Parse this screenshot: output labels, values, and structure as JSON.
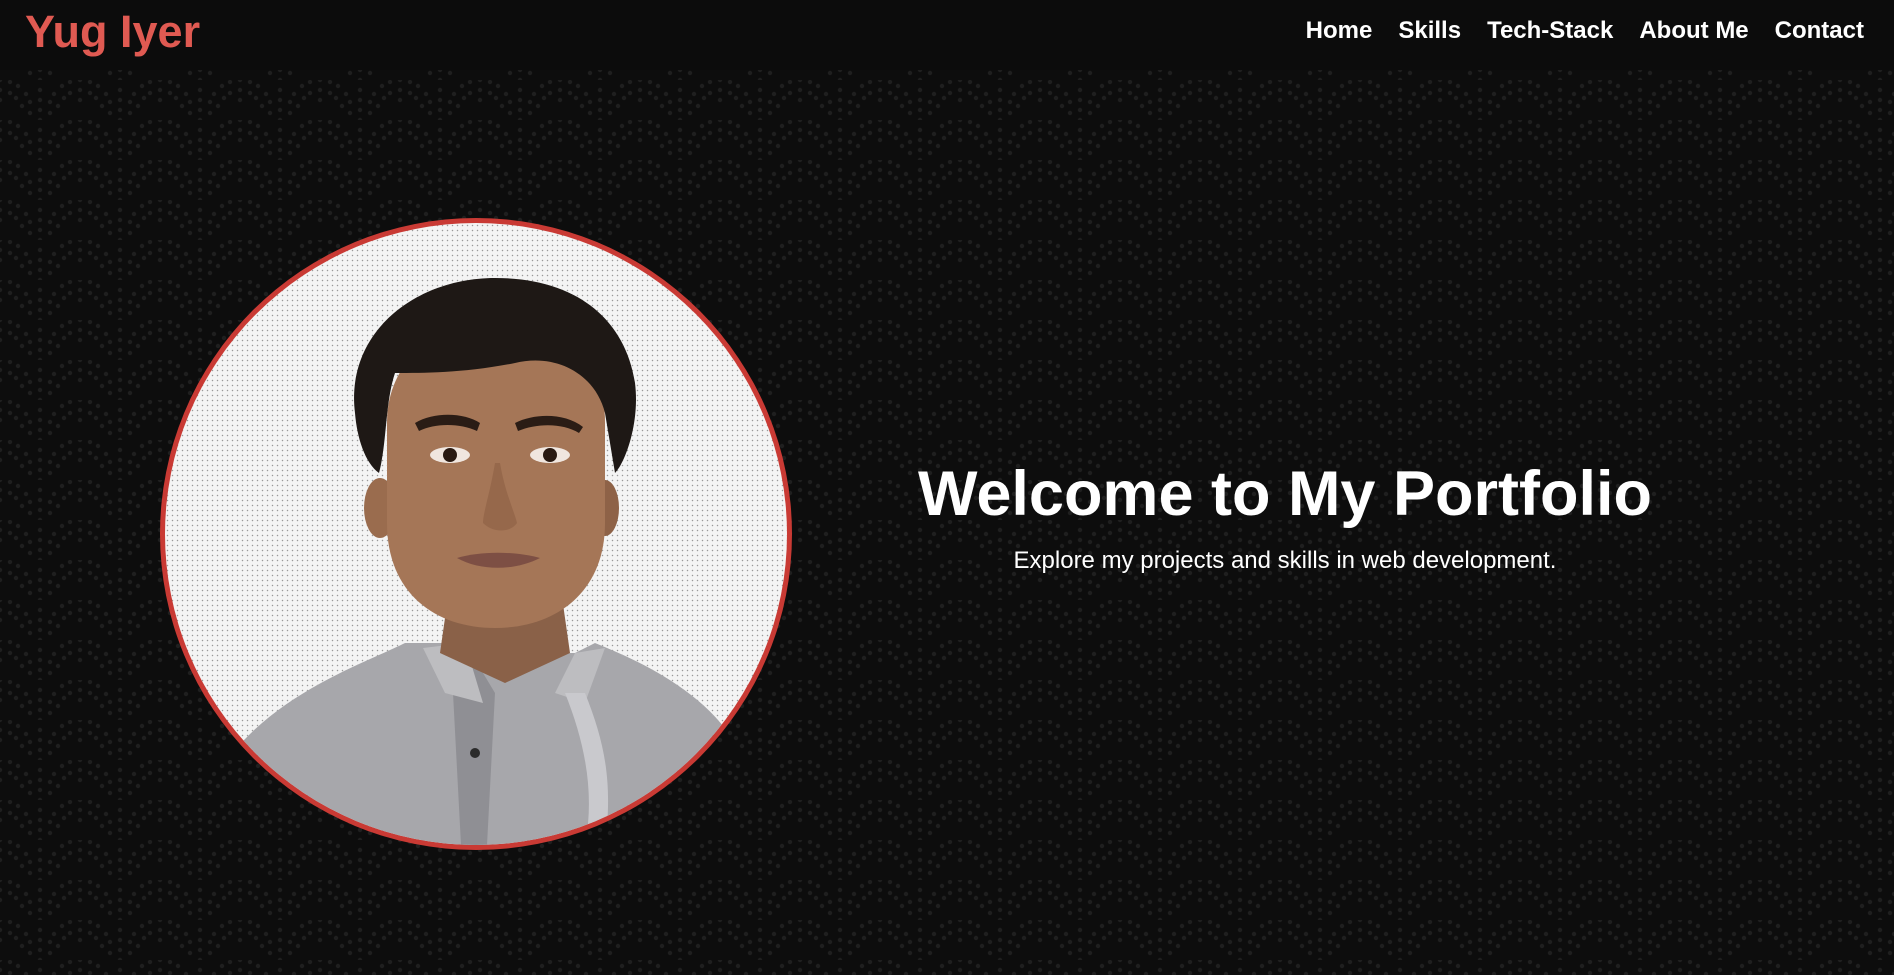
{
  "brand": {
    "name": "Yug Iyer",
    "color": "#e05a52"
  },
  "nav": {
    "items": [
      {
        "label": "Home"
      },
      {
        "label": "Skills"
      },
      {
        "label": "Tech-Stack"
      },
      {
        "label": "About Me"
      },
      {
        "label": "Contact"
      }
    ]
  },
  "hero": {
    "title": "Welcome to My Portfolio",
    "subtitle": "Explore my projects and skills in web development.",
    "portrait_icon": "profile-photo",
    "portrait_border_color": "#c93a34"
  },
  "theme": {
    "background": "#0d0d0d",
    "pattern": "scallop-dots",
    "text": "#ffffff"
  }
}
